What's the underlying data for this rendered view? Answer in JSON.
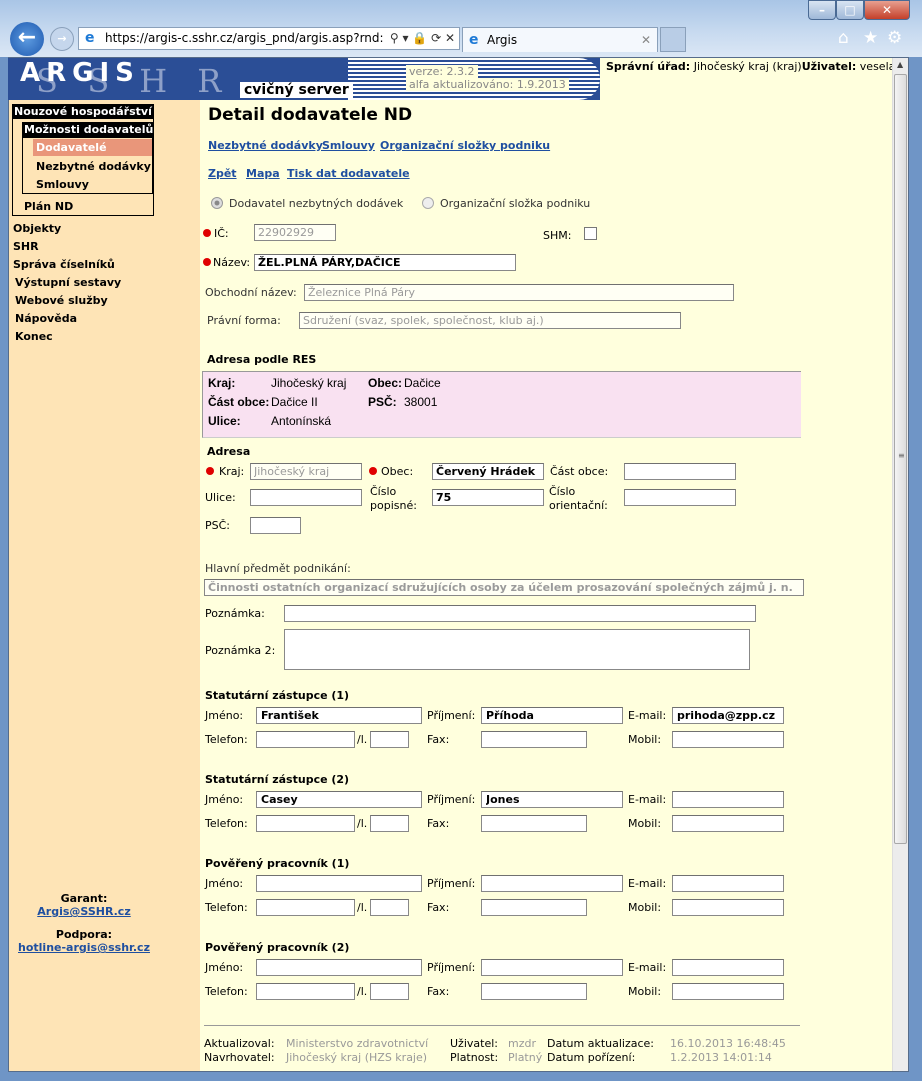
{
  "browser": {
    "url": "https://argis-c.sshr.cz/argis_pnd/argis.asp?rnd:",
    "tab_title": "Argis"
  },
  "header": {
    "logo": "ARGIS",
    "logo_sub": "SSHR",
    "server": "cvičný server",
    "version": "verze: 2.3.2",
    "updated": "alfa aktualizováno: 1.9.2013",
    "office_label": "Správní úřad:",
    "office_value": "Jihočeský kraj (kraj)",
    "user_label": "Uživatel:",
    "user_value": "vesela"
  },
  "sidebar": {
    "group": "Nouzové hospodářství",
    "subgroup": "Možnosti dodavatelů",
    "subitems": [
      "Dodavatelé",
      "Nezbytné dodávky",
      "Smlouvy"
    ],
    "plan": "Plán ND",
    "items": [
      "Objekty",
      "SHR",
      "Správa číselníků",
      "Výstupní sestavy",
      "Webové služby",
      "Nápověda",
      "Konec"
    ],
    "garant_label": "Garant:",
    "garant_email": "Argis@SSHR.cz",
    "support_label": "Podpora:",
    "support_email": "hotline-argis@sshr.cz"
  },
  "main": {
    "title": "Detail dodavatele ND",
    "links1": [
      "Nezbytné dodávky",
      "Smlouvy",
      "Organizační složky podniku"
    ],
    "links2": [
      "Zpět",
      "Mapa",
      "Tisk dat dodavatele"
    ],
    "radio1": "Dodavatel nezbytných dodávek",
    "radio2": "Organizační složka podniku",
    "ic_label": "IČ:",
    "ic_value": "22902929",
    "shm_label": "SHM:",
    "name_label": "Název:",
    "name_value": "ŽEL.PLNÁ PÁRY,DAČICE",
    "trade_label": "Obchodní název:",
    "trade_value": "Železnice Plná Páry",
    "legal_label": "Právní forma:",
    "legal_value": "Sdružení (svaz, spolek, společnost, klub aj.)",
    "res": {
      "title": "Adresa podle RES",
      "kraj_label": "Kraj:",
      "kraj": "Jihočeský kraj",
      "obec_label": "Obec:",
      "obec": "Dačice",
      "cast_label": "Část obce:",
      "cast": "Dačice II",
      "psc_label": "PSČ:",
      "psc": "38001",
      "ulice_label": "Ulice:",
      "ulice": "Antonínská"
    },
    "addr": {
      "title": "Adresa",
      "kraj_label": "Kraj:",
      "kraj": "Jihočeský kraj",
      "obec_label": "Obec:",
      "obec": "Červený Hrádek",
      "cast_label": "Část obce:",
      "ulice_label": "Ulice:",
      "cp_label1": "Číslo",
      "cp_label2": "popisné:",
      "cp": "75",
      "co_label1": "Číslo",
      "co_label2": "orientační:",
      "psc_label": "PSČ:"
    },
    "activity_label": "Hlavní předmět podnikání:",
    "activity_value": "Činnosti ostatních organizací sdružujících osoby za účelem prosazování společných zájmů j. n.",
    "note_label": "Poznámka:",
    "note2_label": "Poznámka 2:",
    "contact_labels": {
      "first": "Jméno:",
      "last": "Příjmení:",
      "email": "E-mail:",
      "phone": "Telefon:",
      "ext": "/l.",
      "fax": "Fax:",
      "mobile": "Mobil:"
    },
    "contacts": [
      {
        "title": "Statutární zástupce (1)",
        "first": "František",
        "last": "Příhoda",
        "email": "prihoda@zpp.cz"
      },
      {
        "title": "Statutární zástupce (2)",
        "first": "Casey",
        "last": "Jones",
        "email": ""
      },
      {
        "title": "Pověřený pracovník (1)",
        "first": "",
        "last": "",
        "email": ""
      },
      {
        "title": "Pověřený pracovník (2)",
        "first": "",
        "last": "",
        "email": ""
      }
    ],
    "footer": {
      "updated_by_label": "Aktualizoval:",
      "updated_by": "Ministerstvo zdravotnictví",
      "user_label": "Uživatel:",
      "user": "mzdr",
      "date_upd_label": "Datum aktualizace:",
      "date_upd": "16.10.2013 16:48:45",
      "proposer_label": "Navrhovatel:",
      "proposer": "Jihočeský kraj (HZS kraje)",
      "validity_label": "Platnost:",
      "validity": "Platný",
      "date_acq_label": "Datum pořízení:",
      "date_acq": "1.2.2013 14:01:14"
    }
  }
}
